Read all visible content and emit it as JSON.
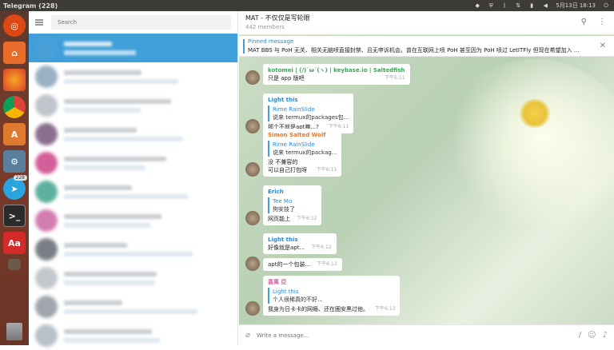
{
  "topbar": {
    "app_title": "Telegram (228)",
    "date_time": "5月13日 18:13",
    "tray_icons": [
      "dropbox-icon",
      "shield-icon",
      "bluetooth-icon",
      "network-icon",
      "battery-icon",
      "volume-icon",
      "power-icon"
    ]
  },
  "launcher": {
    "items": [
      {
        "name": "ubuntu-icon",
        "color": "#dd4814"
      },
      {
        "name": "home-folder-icon",
        "color": "#e86d2a"
      },
      {
        "name": "firefox-icon",
        "color": "#e55b2d"
      },
      {
        "name": "chrome-icon",
        "color": "#e9b129"
      },
      {
        "name": "software-center-icon",
        "color": "#e07a2f"
      },
      {
        "name": "system-settings-icon",
        "color": "#5a7f9c"
      },
      {
        "name": "telegram-icon",
        "color": "#2aa3df",
        "badge": "228"
      },
      {
        "name": "terminal-icon",
        "color": "#2b2b2b"
      },
      {
        "name": "dictionary-icon",
        "color": "#d32a2a",
        "glyph": "Aa"
      },
      {
        "name": "files-icon",
        "color": "#6b5a4c"
      }
    ]
  },
  "chatlist": {
    "search_placeholder": "Search"
  },
  "chat": {
    "title": "MAT - 不仅仅是写轮眼",
    "members": "442 members",
    "pinned_label": "Pinned message",
    "pinned_text": "MAT BBS 与 PoH 无关、相关无脑喷直接封禁、且无申诉机会。曾在互联网上喷 PoH 甚至因为 PoH 喷过 LetITFly 但现在希望加入 ...",
    "composer_placeholder": "Write a message...",
    "messages": [
      {
        "sender": "kotomei | (/)`ω´(ヽ) | keybase.io | Saltedfish",
        "sender_color": "#3aa757",
        "text": "只是 app 版吧",
        "time": "下午6:11"
      },
      {
        "sender": "Light this",
        "sender_color": "#2a8ad4",
        "reply_name": "Rime RainSlide",
        "reply_text": "说来 termux的packages包...",
        "text": "那个不就是apt嘛...?",
        "time": "下午6:11"
      },
      {
        "sender": "Simon Salted Wolf",
        "sender_color": "#e07a2f",
        "reply_name": "Rime RainSlide",
        "reply_text": "说来 termux的packag...",
        "text": "没 不兼容的\n可以自己打包呀",
        "time": "下午6:11"
      },
      {
        "sender": "Erich",
        "sender_color": "#2a8ad4",
        "reply_name": "Tee Mo",
        "reply_text": "狗安技了",
        "text": "网页能上",
        "time": "下午6:12"
      },
      {
        "sender": "Light this",
        "sender_color": "#2a8ad4",
        "text": "好像就是apt...",
        "time": "下午6:12"
      },
      {
        "sender": "",
        "sender_color": "#2a8ad4",
        "text": "apt的一个包装...",
        "time": "下午6:13"
      },
      {
        "sender": "喜离 亞",
        "sender_color": "#d65fa6",
        "reply_name": "Light this",
        "reply_text": "个人很稀真的不好...",
        "text": "我身为日卡卡的网瘾、还在圈安黑过他。",
        "time": "下午6:13"
      }
    ]
  },
  "colors": {
    "accent": "#419fd9",
    "topbar": "#3c3b37"
  }
}
